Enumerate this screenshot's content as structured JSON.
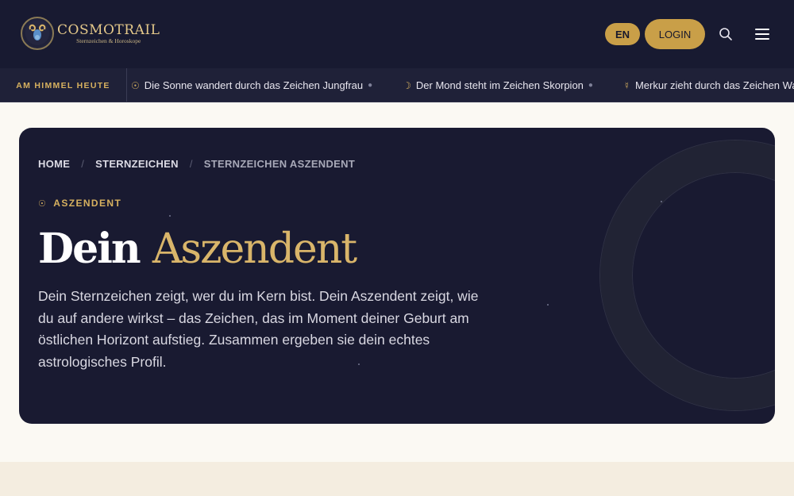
{
  "header": {
    "logo_title": "COSMOTRAIL",
    "logo_subtitle": "Sternzeichen & Horoskope",
    "lang_label": "EN",
    "login_label": "LOGIN",
    "search_icon": "search-icon",
    "menu_icon": "hamburger-menu-icon"
  },
  "ticker": {
    "label": "AM HIMMEL HEUTE",
    "items": [
      {
        "symbol": "☉",
        "text": "Die Sonne wandert durch das Zeichen Jungfrau"
      },
      {
        "symbol": "☽",
        "text": "Der Mond steht im Zeichen Skorpion"
      },
      {
        "symbol": "☿",
        "text": "Merkur zieht durch das Zeichen Waage"
      }
    ]
  },
  "hero": {
    "breadcrumb": [
      "HOME",
      "STERNZEICHEN",
      "STERNZEICHEN ASZENDENT"
    ],
    "eyebrow_symbol": "☉",
    "eyebrow": "ASZENDENT",
    "title_main": "Dein",
    "title_accent": "Aszendent",
    "lead": "Dein Sternzeichen zeigt, wer du im Kern bist. Dein Aszendent zeigt, wie du auf andere wirkst – das Zeichen, das im Moment deiner Geburt am östlichen Horizont aufstieg. Zusammen ergeben sie dein echtes astrologisches Profil."
  },
  "colors": {
    "navy": "#181a31",
    "gold": "#c99f48",
    "cream": "#fbf9f3"
  }
}
